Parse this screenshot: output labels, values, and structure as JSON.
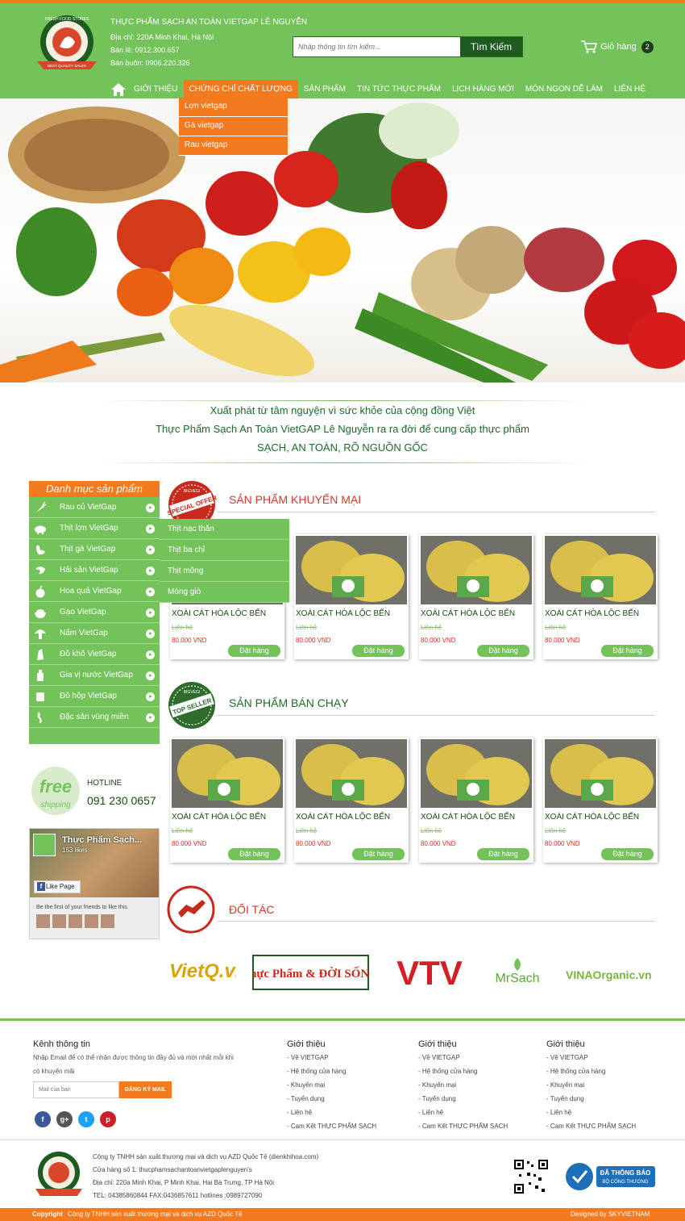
{
  "header": {
    "shop_name": "THỰC PHẨM SẠCH AN TOÀN VIETGAP LÊ NGUYỄN",
    "address": "Địa chỉ: 220A Minh Khai, Hà Nội",
    "retail": "Bán lẻ: 0912.300.657",
    "wholesale": "Bán buôn: 0906.220.326",
    "search_placeholder": "Nhập thông tin tìm kiếm...",
    "search_button": "Tìm Kiếm",
    "cart_label": "Giỏ hàng",
    "cart_count": "2",
    "logo_text": "FRESH FOOD STORES",
    "logo_sub": "BEST QUALITY SALES"
  },
  "nav": {
    "items": [
      "GIỚI THIỆU",
      "CHỨNG CHỈ CHẤT LƯỢNG",
      "SẢN PHẨM",
      "TIN TỨC THỰC PHẨM",
      "LỊCH HÀNG MỚI",
      "MÓN NGON DỄ LÀM",
      "LIÊN HỆ"
    ],
    "dropdown": [
      "Lợn vietgap",
      "Gà vietgap",
      "Rau vietgap"
    ]
  },
  "slogan": {
    "line1": "Xuất phát từ tâm nguyện vì sức khỏe của cộng đồng Việt",
    "line2": "Thực Phẩm Sạch An Toàn VietGAP Lê Nguyễn ra ra đời để cung cấp thực phẩm",
    "line3": "SẠCH, AN TOÀN, RÕ NGUỒN GỐC"
  },
  "categories": {
    "title": "Danh mục sản phẩm",
    "items": [
      "Rau củ VietGap",
      "Thịt lợn VietGap",
      "Thịt gà VietGap",
      "Hải sản VietGap",
      "Hoa quả VietGap",
      "Gạo VietGap",
      "Nấm VietGap",
      "Đồ khô VietGap",
      "Gia vị nước VietGap",
      "Đồ hộp VietGap",
      "Đặc sản vùng miền"
    ],
    "submenu": [
      "Thịt nạc thăn",
      "Thịt ba chỉ",
      "Thịt mông",
      "Móng giò"
    ]
  },
  "sections": {
    "promo_title": "SẢN PHẨM KHUYẾN MẠI",
    "best_title": "SẢN PHẨM BÁN CHẠY",
    "partners_title": "ĐỐI TÁC",
    "promo_badge": "SPECIAL OFFER",
    "best_badge": "TOP SELLER",
    "badge_small": "BIGVEGI"
  },
  "product": {
    "name": "XOÀI CÁT HÒA LỘC BẾN",
    "old_price": "Liên hệ",
    "price": "80.000 VND",
    "order": "Đặt hàng"
  },
  "hotline": {
    "free": "free",
    "shipping": "shipping",
    "label": "HOTLINE",
    "number": "091 230 0657"
  },
  "facebook": {
    "page_name": "Thực Phẩm Sạch...",
    "likes": "153 likes",
    "like_button": "Like Page",
    "friends_text": "Be the first of your friends to like this"
  },
  "partners": [
    "VietQ.vn",
    "Thực Phẩm & ĐỜI SỐNG",
    "VTV",
    "MrSach",
    "VINAOrganic.vn"
  ],
  "footer": {
    "news_title": "Kênh thông tin",
    "news_desc_1": "Nhập Email để có thể nhận được thông tin đầy đủ và mới nhất mỗi khi",
    "news_desc_2": "có khuyến mãi",
    "email_placeholder": "Mail của bạn",
    "subscribe": "ĐĂNG KÝ MAIL",
    "col_title": "Giới thiệu",
    "col_links": [
      "- Về VIETGAP",
      "- Hệ thống cửa hàng",
      "- Khuyến mại",
      "- Tuyển dụng",
      "- Liên hệ",
      "- Cam Kết THỰC PHẨM SẠCH"
    ],
    "company": "Công ty TNHH sản xuất thương mại và dịch vụ AZD Quốc Tế (dienkhihoa.com)",
    "store": "Cửa hàng số 1: thucphamsachantoanvietgaplenguyen's",
    "address": "Địa chỉ: 220a Minh Khai, P Minh Khai, Hai Bà Trưng, TP Hà Nội",
    "phones": "TEL: 04385860844 FAX:0436857611 hotlines :0989727090",
    "bct_1": "ĐÃ THÔNG BÁO",
    "bct_2": "BỘ CÔNG THƯƠNG",
    "copyright_label": "Copyright",
    "copyright": "Công ty TNHH sản xuất thương mại và dịch vụ AZD Quốc Tế",
    "designed": "Designed by SKYVIETNAM"
  },
  "colors": {
    "green": "#74c25a",
    "dark_green": "#1e5b20",
    "orange": "#f47a20",
    "red": "#d23a2a"
  }
}
